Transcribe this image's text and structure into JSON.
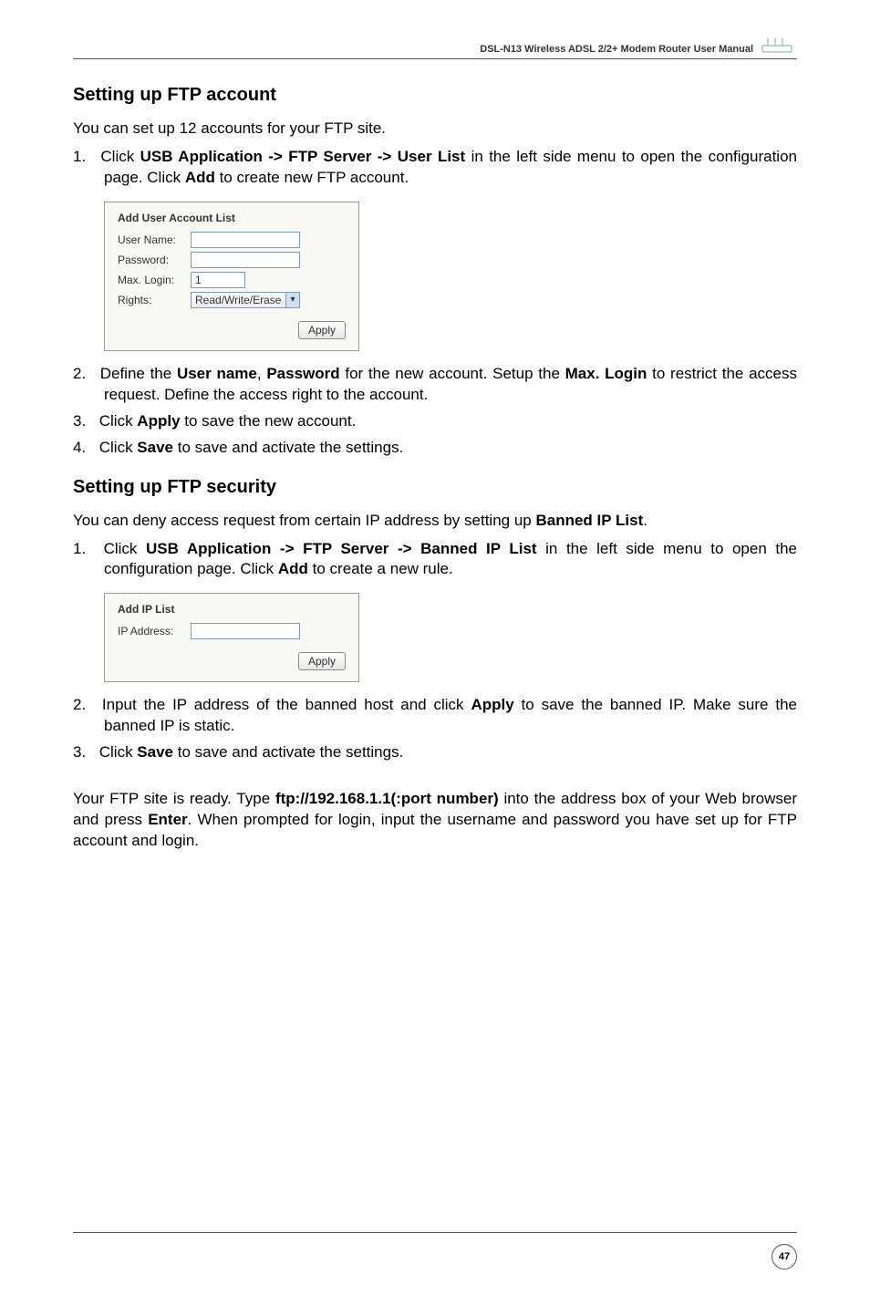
{
  "header": {
    "title": "DSL-N13 Wireless ADSL 2/2+ Modem Router User Manual"
  },
  "section1": {
    "heading": "Setting up FTP account",
    "intro": "You can set up 12 accounts for your FTP site.",
    "step1_pre": "Click ",
    "step1_bold": "USB Application -> FTP Server -> User List",
    "step1_mid": " in the left side menu to open the configuration page. Click ",
    "step1_bold2": "Add",
    "step1_post": " to create new FTP account.",
    "step2_pre": "Define the ",
    "step2_b1": "User name",
    "step2_sep1": ", ",
    "step2_b2": "Password",
    "step2_mid": " for the new account. Setup the ",
    "step2_b3": "Max. Login",
    "step2_post": " to restrict the access request. Define the access right to the account.",
    "step3_pre": "Click ",
    "step3_b": "Apply",
    "step3_post": " to save the new account.",
    "step4_pre": "Click ",
    "step4_b": "Save",
    "step4_post": " to save and activate the settings."
  },
  "uibox1": {
    "title": "Add User Account List",
    "label_user": "User Name:",
    "label_pass": "Password:",
    "label_max": "Max. Login:",
    "label_rights": "Rights:",
    "value_user": "",
    "value_pass": "",
    "value_max": "1",
    "value_rights": "Read/Write/Erase",
    "apply": "Apply"
  },
  "section2": {
    "heading": "Setting up FTP security",
    "intro_pre": "You can deny access request from certain IP address by setting up ",
    "intro_b": "Banned IP List",
    "intro_post": ".",
    "step1_pre": "Click ",
    "step1_bold": "USB Application -> FTP Server -> Banned IP List",
    "step1_mid": " in the left side menu to open the configuration page. Click ",
    "step1_bold2": "Add",
    "step1_post": " to create a new rule.",
    "step2_pre": "Input the IP address of the banned host and click ",
    "step2_b": "Apply",
    "step2_post": " to save the banned IP. Make sure the banned IP is static.",
    "step3_pre": "Click ",
    "step3_b": "Save",
    "step3_post": " to save and activate the settings."
  },
  "uibox2": {
    "title": "Add IP List",
    "label_ip": "IP Address:",
    "value_ip": "",
    "apply": "Apply"
  },
  "closing": {
    "pre": "Your FTP site is ready. Type ",
    "b1": "ftp://192.168.1.1(:port number)",
    "mid1": " into the address box of your Web browser and press ",
    "b2": "Enter",
    "post": ". When prompted for login, input the username and password you have set up for FTP account and login."
  },
  "page_number": "47"
}
